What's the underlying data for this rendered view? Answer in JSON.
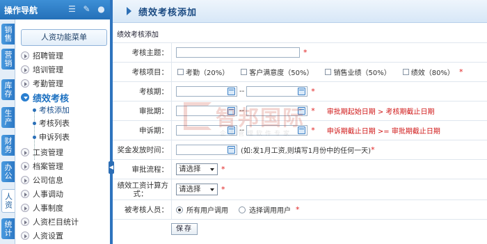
{
  "nav": {
    "title": "操作导航",
    "icons": [
      "list-icon",
      "wrench-icon",
      "user-icon"
    ]
  },
  "vtabs": [
    {
      "label": "销售"
    },
    {
      "label": "营销"
    },
    {
      "label": "库存"
    },
    {
      "label": "生产"
    },
    {
      "label": "财务"
    },
    {
      "label": "办公"
    },
    {
      "label": "人资"
    },
    {
      "label": "统计"
    }
  ],
  "menu": {
    "header_button": "人资功能菜单",
    "items": [
      {
        "label": "招聘管理"
      },
      {
        "label": "培训管理"
      },
      {
        "label": "考勤管理"
      },
      {
        "label": "绩效考核"
      },
      {
        "label": "工资管理"
      },
      {
        "label": "档案管理"
      },
      {
        "label": "公司信息"
      },
      {
        "label": "人事调动"
      },
      {
        "label": "人事制度"
      },
      {
        "label": "人资栏目统计"
      },
      {
        "label": "人资设置"
      }
    ],
    "sub_items": [
      {
        "label": "考核添加"
      },
      {
        "label": "考核列表"
      },
      {
        "label": "申诉列表"
      }
    ]
  },
  "header": {
    "title": "绩效考核添加"
  },
  "form": {
    "section_title": "绩效考核添加",
    "subject_label": "考核主题：",
    "items_label": "考核项目：",
    "items": [
      {
        "label": "考勤（20%）"
      },
      {
        "label": "客户满意度（50%）"
      },
      {
        "label": "销售业绩（50%）"
      },
      {
        "label": "绩效（80%）"
      }
    ],
    "period_label": "考核期：",
    "approval_period_label": "审批期：",
    "approval_hint": "审批期起始日期 > 考核期截止日期",
    "appeal_period_label": "申诉期：",
    "appeal_hint": "申诉期截止日期 >= 审批期截止日期",
    "bonus_time_label": "奖金发放时间：",
    "bonus_hint": "(如:发1月工资,则填写1月份中的任何一天)",
    "flow_label": "审批流程：",
    "flow_value": "请选择",
    "formula_label_1": "绩效工资计算方",
    "formula_label_2": "式：",
    "formula_value": "请选择",
    "staff_label": "被考核人员：",
    "staff_options": [
      {
        "label": "所有用户调用",
        "checked": true
      },
      {
        "label": "选择调用用户",
        "checked": false
      }
    ],
    "range_sep": "--",
    "required_mark": "*",
    "save_button": "保存"
  },
  "watermark": {
    "name": "智邦国际",
    "tagline": "企业管理软件专家"
  },
  "colors": {
    "nav_blue": "#2470b8",
    "required_red": "#e02020",
    "hint_red": "#d01818"
  }
}
